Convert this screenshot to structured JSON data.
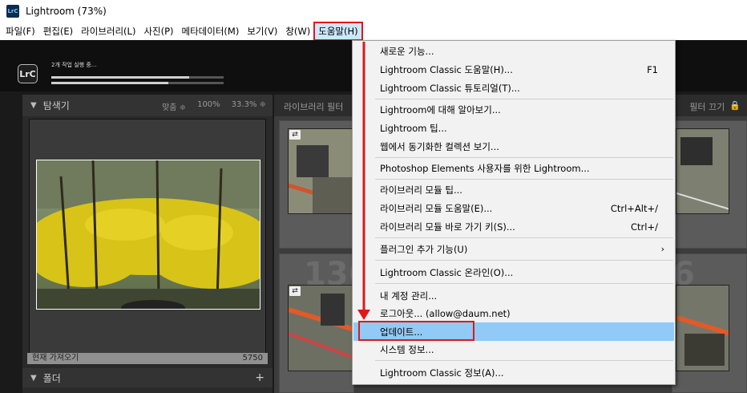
{
  "window": {
    "title": "Lightroom (73%)",
    "logo_text": "LrC"
  },
  "menubar": {
    "items": [
      "파일(F)",
      "편집(E)",
      "라이브러리(L)",
      "사진(P)",
      "메타데이터(M)",
      "보기(V)",
      "창(W)",
      "도움말(H)"
    ],
    "active_index": 7
  },
  "task": {
    "badge": "LrC",
    "status": "2개 작업 실행 중...",
    "progress_1": 0.8,
    "progress_2": 0.68
  },
  "navigator": {
    "title": "탐색기",
    "options": [
      "맞춤 ≑",
      "100%",
      "33.3% ≑"
    ],
    "catalog_row_label": "현재 가져오기",
    "catalog_row_count": "5750"
  },
  "folders": {
    "title": "폴더",
    "add_icon": "+"
  },
  "filter_bar": {
    "left_label": "라이브러리 필터",
    "right_label": "필터 끄기"
  },
  "grid": {
    "cell_numbers": [
      "1362",
      "6"
    ]
  },
  "help_menu": {
    "items": [
      {
        "label": "새로운 기능...",
        "shortcut": ""
      },
      {
        "label": "Lightroom Classic 도움말(H)...",
        "shortcut": "F1"
      },
      {
        "label": "Lightroom Classic 튜토리얼(T)...",
        "shortcut": ""
      },
      {
        "label": "Lightroom에 대해 알아보기...",
        "shortcut": ""
      },
      {
        "label": "Lightroom 팁...",
        "shortcut": ""
      },
      {
        "label": "웹에서 동기화한 컬렉션 보기...",
        "shortcut": ""
      },
      {
        "label": "Photoshop Elements 사용자를 위한 Lightroom...",
        "shortcut": ""
      },
      {
        "label": "라이브러리 모듈 팁...",
        "shortcut": ""
      },
      {
        "label": "라이브러리 모듈 도움말(E)...",
        "shortcut": "Ctrl+Alt+/"
      },
      {
        "label": "라이브러리 모듈 바로 가기 키(S)...",
        "shortcut": "Ctrl+/"
      },
      {
        "label": "플러그인 추가 기능(U)",
        "shortcut": ""
      },
      {
        "label": "Lightroom Classic 온라인(O)...",
        "shortcut": ""
      },
      {
        "label": "내 계정 관리...",
        "shortcut": ""
      },
      {
        "label": "로그아웃... (allow@daum.net)",
        "shortcut": ""
      },
      {
        "label": "업데이트...",
        "shortcut": ""
      },
      {
        "label": "시스템 정보...",
        "shortcut": ""
      },
      {
        "label": "Lightroom Classic 정보(A)...",
        "shortcut": ""
      }
    ],
    "submenu_arrow": "›",
    "highlighted_index": 14
  },
  "colors": {
    "annotation": "#e0161b",
    "highlight": "#91c9f7"
  }
}
